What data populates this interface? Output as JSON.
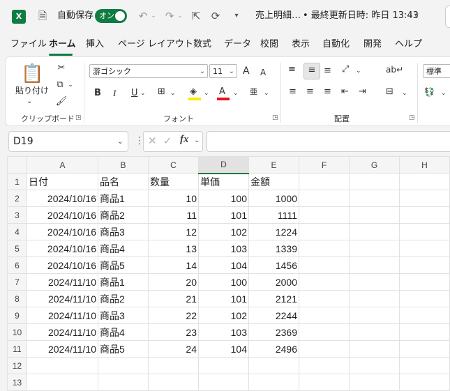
{
  "titlebar": {
    "app_icon": "X",
    "autosave_label": "自動保存",
    "autosave_state": "オン",
    "doc_title": "売上明細…",
    "saved_status": "• 最終更新日時: 昨日 13:43",
    "icons": [
      "save-icon",
      "undo-icon",
      "redo-icon",
      "touch-mode-icon",
      "refresh-icon",
      "customize-qat-icon"
    ]
  },
  "menu": [
    "ファイル",
    "ホーム",
    "挿入",
    "ページ レイアウト",
    "数式",
    "データ",
    "校閲",
    "表示",
    "自動化",
    "開発",
    "ヘルプ"
  ],
  "ribbon": {
    "clipboard": {
      "paste_label": "貼り付け",
      "group_label": "クリップボード"
    },
    "font": {
      "font_name": "游ゴシック",
      "font_size": "11",
      "bold": "B",
      "italic": "I",
      "underline": "U",
      "grow": "A",
      "shrink": "A",
      "font_color": "A",
      "group_label": "フォント"
    },
    "alignment": {
      "group_label": "配置"
    },
    "number": {
      "format": "標準"
    },
    "colors": {
      "accent": "#107c41",
      "highlight": "#ffe800",
      "font_red": "#e81123"
    }
  },
  "formula_bar": {
    "name_box": "D19",
    "fx": "fx",
    "formula": ""
  },
  "grid": {
    "columns": [
      "A",
      "B",
      "C",
      "D",
      "E",
      "F",
      "G",
      "H"
    ],
    "active_column": "D",
    "rows": [
      {
        "n": "1",
        "cells": [
          "日付",
          "品名",
          "数量",
          "単価",
          "金額",
          "",
          "",
          ""
        ]
      },
      {
        "n": "2",
        "cells": [
          "2024/10/16",
          "商品1",
          "10",
          "100",
          "1000",
          "",
          "",
          ""
        ]
      },
      {
        "n": "3",
        "cells": [
          "2024/10/16",
          "商品2",
          "11",
          "101",
          "1111",
          "",
          "",
          ""
        ]
      },
      {
        "n": "4",
        "cells": [
          "2024/10/16",
          "商品3",
          "12",
          "102",
          "1224",
          "",
          "",
          ""
        ]
      },
      {
        "n": "5",
        "cells": [
          "2024/10/16",
          "商品4",
          "13",
          "103",
          "1339",
          "",
          "",
          ""
        ]
      },
      {
        "n": "6",
        "cells": [
          "2024/10/16",
          "商品5",
          "14",
          "104",
          "1456",
          "",
          "",
          ""
        ]
      },
      {
        "n": "7",
        "cells": [
          "2024/11/10",
          "商品1",
          "20",
          "100",
          "2000",
          "",
          "",
          ""
        ]
      },
      {
        "n": "8",
        "cells": [
          "2024/11/10",
          "商品2",
          "21",
          "101",
          "2121",
          "",
          "",
          ""
        ]
      },
      {
        "n": "9",
        "cells": [
          "2024/11/10",
          "商品3",
          "22",
          "102",
          "2244",
          "",
          "",
          ""
        ]
      },
      {
        "n": "10",
        "cells": [
          "2024/11/10",
          "商品4",
          "23",
          "103",
          "2369",
          "",
          "",
          ""
        ]
      },
      {
        "n": "11",
        "cells": [
          "2024/11/10",
          "商品5",
          "24",
          "104",
          "2496",
          "",
          "",
          ""
        ]
      },
      {
        "n": "12",
        "cells": [
          "",
          "",
          "",
          "",
          "",
          "",
          "",
          ""
        ]
      },
      {
        "n": "13",
        "cells": [
          "",
          "",
          "",
          "",
          "",
          "",
          "",
          ""
        ]
      }
    ]
  }
}
